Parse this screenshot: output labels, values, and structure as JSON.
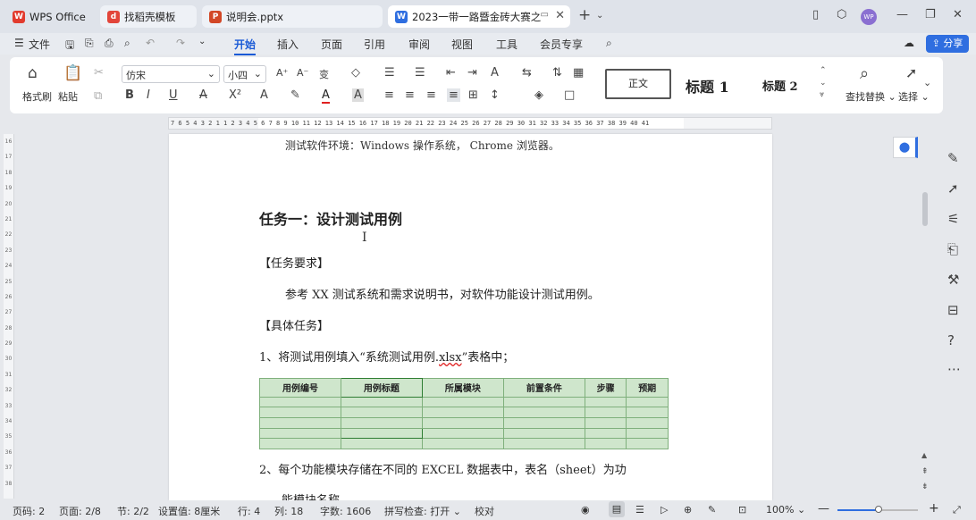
{
  "tabs": [
    {
      "label": "WPS Office",
      "color": "#e23b2e",
      "glyph": "W"
    },
    {
      "label": "找稻壳模板",
      "color": "#e2453a",
      "glyph": "d"
    },
    {
      "label": "说明会.pptx",
      "color": "#d24726",
      "glyph": "P"
    },
    {
      "label": "2023一带一路暨金砖大赛之【",
      "color": "#2f6ee0",
      "glyph": "W"
    }
  ],
  "menu": {
    "file": "文件",
    "items": [
      "开始",
      "插入",
      "页面",
      "引用",
      "审阅",
      "视图",
      "工具",
      "会员专享"
    ],
    "share": "分享"
  },
  "ribbon": {
    "format_painter": "格式刷",
    "paste": "粘贴",
    "font_name": "仿宋",
    "font_size": "小四",
    "style_normal": "正文",
    "style_h1": "标题 1",
    "style_h2": "标题 2",
    "find_replace": "查找替换",
    "select": "选择"
  },
  "ruler": {
    "numbers": "7 6 5 4 3 2 1   1 2 3 4 5 6 7 8 9 10 11 12 13 14 15 16 17 18 19 20 21 22 23 24 25 26 27 28 29 30 31 32 33 34 35 36 37 38 39 40 41"
  },
  "vruler": [
    "16",
    "17",
    "18",
    "19",
    "20",
    "21",
    "22",
    "23",
    "24",
    "25",
    "26",
    "27",
    "28",
    "29",
    "30",
    "31",
    "32",
    "33",
    "34",
    "35",
    "36",
    "37",
    "38"
  ],
  "doc": {
    "env": "测试软件环境：Windows 操作系统， Chrome 浏览器。",
    "heading": "任务一：设计测试用例",
    "req_title": "【任务要求】",
    "req_body": "参考 XX 测试系统和需求说明书，对软件功能设计测试用例。",
    "task_title": "【具体任务】",
    "item1_a": "1、将测试用例填入“系统测试用例.",
    "item1_link": "xlsx",
    "item1_b": "”表格中；",
    "table_headers": [
      "用例编号",
      "用例标题",
      "所属模块",
      "前置条件",
      "步骤",
      "预期"
    ],
    "item2": "2、每个功能模块存储在不同的 EXCEL 数据表中，表名（sheet）为功",
    "item2_cont": "能模块名称。"
  },
  "status": {
    "page_num": "页码: 2",
    "pages": "页面: 2/8",
    "section": "节: 2/2",
    "setting": "设置值: 8厘米",
    "row": "行: 4",
    "col": "列: 18",
    "words": "字数: 1606",
    "spell": "拼写检查: 打开",
    "proof": "校对",
    "zoom": "100%"
  }
}
